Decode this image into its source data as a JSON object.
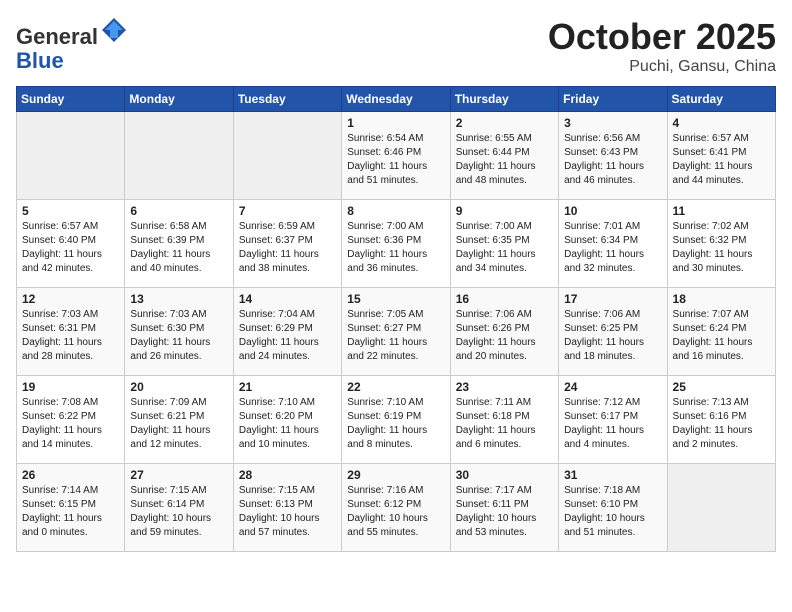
{
  "header": {
    "logo_general": "General",
    "logo_blue": "Blue",
    "month": "October 2025",
    "location": "Puchi, Gansu, China"
  },
  "weekdays": [
    "Sunday",
    "Monday",
    "Tuesday",
    "Wednesday",
    "Thursday",
    "Friday",
    "Saturday"
  ],
  "weeks": [
    [
      {
        "day": "",
        "info": ""
      },
      {
        "day": "",
        "info": ""
      },
      {
        "day": "",
        "info": ""
      },
      {
        "day": "1",
        "info": "Sunrise: 6:54 AM\nSunset: 6:46 PM\nDaylight: 11 hours\nand 51 minutes."
      },
      {
        "day": "2",
        "info": "Sunrise: 6:55 AM\nSunset: 6:44 PM\nDaylight: 11 hours\nand 48 minutes."
      },
      {
        "day": "3",
        "info": "Sunrise: 6:56 AM\nSunset: 6:43 PM\nDaylight: 11 hours\nand 46 minutes."
      },
      {
        "day": "4",
        "info": "Sunrise: 6:57 AM\nSunset: 6:41 PM\nDaylight: 11 hours\nand 44 minutes."
      }
    ],
    [
      {
        "day": "5",
        "info": "Sunrise: 6:57 AM\nSunset: 6:40 PM\nDaylight: 11 hours\nand 42 minutes."
      },
      {
        "day": "6",
        "info": "Sunrise: 6:58 AM\nSunset: 6:39 PM\nDaylight: 11 hours\nand 40 minutes."
      },
      {
        "day": "7",
        "info": "Sunrise: 6:59 AM\nSunset: 6:37 PM\nDaylight: 11 hours\nand 38 minutes."
      },
      {
        "day": "8",
        "info": "Sunrise: 7:00 AM\nSunset: 6:36 PM\nDaylight: 11 hours\nand 36 minutes."
      },
      {
        "day": "9",
        "info": "Sunrise: 7:00 AM\nSunset: 6:35 PM\nDaylight: 11 hours\nand 34 minutes."
      },
      {
        "day": "10",
        "info": "Sunrise: 7:01 AM\nSunset: 6:34 PM\nDaylight: 11 hours\nand 32 minutes."
      },
      {
        "day": "11",
        "info": "Sunrise: 7:02 AM\nSunset: 6:32 PM\nDaylight: 11 hours\nand 30 minutes."
      }
    ],
    [
      {
        "day": "12",
        "info": "Sunrise: 7:03 AM\nSunset: 6:31 PM\nDaylight: 11 hours\nand 28 minutes."
      },
      {
        "day": "13",
        "info": "Sunrise: 7:03 AM\nSunset: 6:30 PM\nDaylight: 11 hours\nand 26 minutes."
      },
      {
        "day": "14",
        "info": "Sunrise: 7:04 AM\nSunset: 6:29 PM\nDaylight: 11 hours\nand 24 minutes."
      },
      {
        "day": "15",
        "info": "Sunrise: 7:05 AM\nSunset: 6:27 PM\nDaylight: 11 hours\nand 22 minutes."
      },
      {
        "day": "16",
        "info": "Sunrise: 7:06 AM\nSunset: 6:26 PM\nDaylight: 11 hours\nand 20 minutes."
      },
      {
        "day": "17",
        "info": "Sunrise: 7:06 AM\nSunset: 6:25 PM\nDaylight: 11 hours\nand 18 minutes."
      },
      {
        "day": "18",
        "info": "Sunrise: 7:07 AM\nSunset: 6:24 PM\nDaylight: 11 hours\nand 16 minutes."
      }
    ],
    [
      {
        "day": "19",
        "info": "Sunrise: 7:08 AM\nSunset: 6:22 PM\nDaylight: 11 hours\nand 14 minutes."
      },
      {
        "day": "20",
        "info": "Sunrise: 7:09 AM\nSunset: 6:21 PM\nDaylight: 11 hours\nand 12 minutes."
      },
      {
        "day": "21",
        "info": "Sunrise: 7:10 AM\nSunset: 6:20 PM\nDaylight: 11 hours\nand 10 minutes."
      },
      {
        "day": "22",
        "info": "Sunrise: 7:10 AM\nSunset: 6:19 PM\nDaylight: 11 hours\nand 8 minutes."
      },
      {
        "day": "23",
        "info": "Sunrise: 7:11 AM\nSunset: 6:18 PM\nDaylight: 11 hours\nand 6 minutes."
      },
      {
        "day": "24",
        "info": "Sunrise: 7:12 AM\nSunset: 6:17 PM\nDaylight: 11 hours\nand 4 minutes."
      },
      {
        "day": "25",
        "info": "Sunrise: 7:13 AM\nSunset: 6:16 PM\nDaylight: 11 hours\nand 2 minutes."
      }
    ],
    [
      {
        "day": "26",
        "info": "Sunrise: 7:14 AM\nSunset: 6:15 PM\nDaylight: 11 hours\nand 0 minutes."
      },
      {
        "day": "27",
        "info": "Sunrise: 7:15 AM\nSunset: 6:14 PM\nDaylight: 10 hours\nand 59 minutes."
      },
      {
        "day": "28",
        "info": "Sunrise: 7:15 AM\nSunset: 6:13 PM\nDaylight: 10 hours\nand 57 minutes."
      },
      {
        "day": "29",
        "info": "Sunrise: 7:16 AM\nSunset: 6:12 PM\nDaylight: 10 hours\nand 55 minutes."
      },
      {
        "day": "30",
        "info": "Sunrise: 7:17 AM\nSunset: 6:11 PM\nDaylight: 10 hours\nand 53 minutes."
      },
      {
        "day": "31",
        "info": "Sunrise: 7:18 AM\nSunset: 6:10 PM\nDaylight: 10 hours\nand 51 minutes."
      },
      {
        "day": "",
        "info": ""
      }
    ]
  ]
}
